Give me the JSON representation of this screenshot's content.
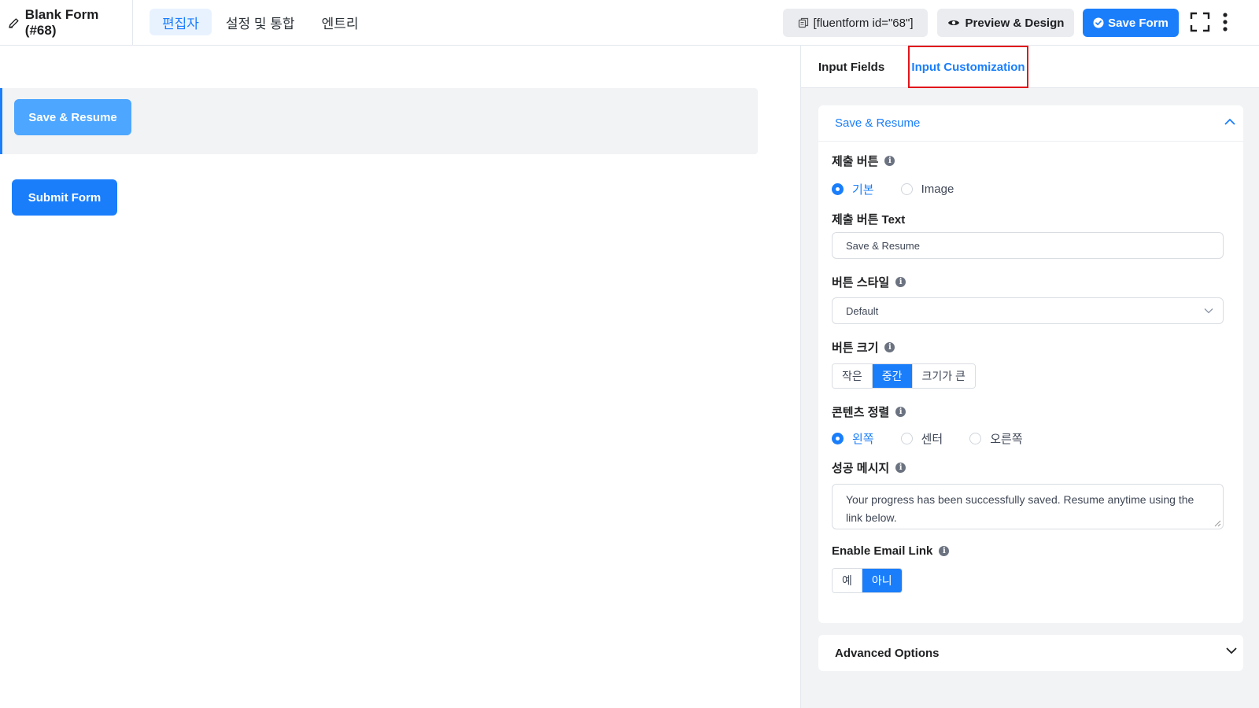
{
  "header": {
    "form_title": "Blank Form (#68)",
    "tabs": [
      {
        "label": "편집자",
        "active": true
      },
      {
        "label": "설정 및 통합",
        "active": false
      },
      {
        "label": "엔트리",
        "active": false
      }
    ],
    "shortcode_label": "[fluentform id=\"68\"]",
    "preview_label": "Preview & Design",
    "save_label": "Save Form"
  },
  "editor": {
    "save_resume_button": "Save & Resume",
    "submit_button": "Submit Form"
  },
  "sidebar": {
    "tabs": [
      {
        "label": "Input Fields",
        "active": false
      },
      {
        "label": "Input Customization",
        "active": true
      }
    ],
    "panel": {
      "title": "Save & Resume",
      "submit_button_label": "제출 버튼",
      "submit_button_options": [
        "기본",
        "Image"
      ],
      "submit_button_selected": "기본",
      "button_text_label": "제출 버튼 Text",
      "button_text_value": "Save & Resume",
      "button_style_label": "버튼 스타일",
      "button_style_value": "Default",
      "button_size_label": "버튼 크기",
      "button_size_options": [
        "작은",
        "중간",
        "크기가 큰"
      ],
      "button_size_selected": "중간",
      "alignment_label": "콘텐츠 정렬",
      "alignment_options": [
        "왼쪽",
        "센터",
        "오른쪽"
      ],
      "alignment_selected": "왼쪽",
      "success_message_label": "성공 메시지",
      "success_message_value": "Your progress has been successfully saved. Resume anytime using the link below.",
      "email_link_label": "Enable Email Link",
      "email_link_options": [
        "예",
        "아니"
      ],
      "email_link_selected": "아니"
    },
    "advanced_title": "Advanced Options"
  },
  "colors": {
    "accent": "#1a7efb",
    "highlight_box": "#e1141b"
  }
}
